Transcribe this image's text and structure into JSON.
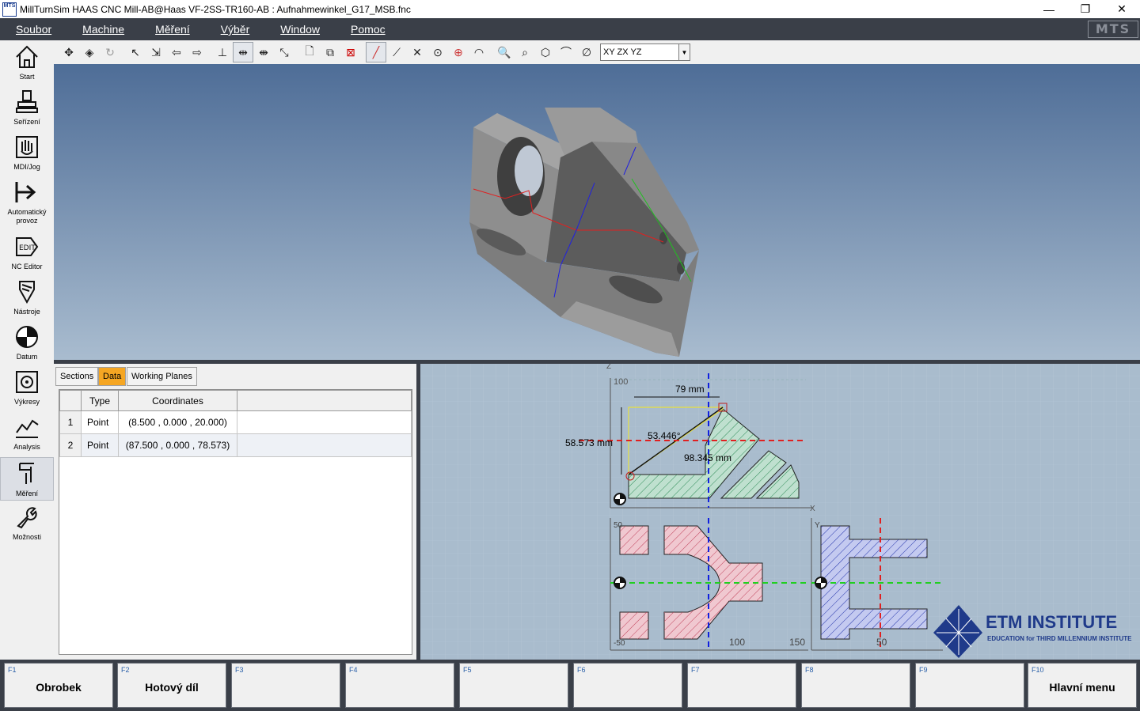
{
  "window": {
    "title": "MillTurnSim HAAS CNC Mill-AB@Haas VF-2SS-TR160-AB : Aufnahmewinkel_G17_MSB.fnc",
    "logo": "MTS",
    "minimize": "—",
    "restore": "❐",
    "close": "✕"
  },
  "menu": {
    "items": [
      "Soubor",
      "Machine",
      "Měření",
      "Výběr",
      "Window",
      "Pomoc"
    ],
    "logo": "MTS"
  },
  "sidebar": {
    "items": [
      {
        "label": "Start",
        "icon": "home-icon"
      },
      {
        "label": "Seřízení",
        "icon": "machine-setup-icon"
      },
      {
        "label": "MDI/Jog",
        "icon": "hand-jog-icon"
      },
      {
        "label": "Automatický provoz",
        "icon": "auto-run-icon"
      },
      {
        "label": "NC Editor",
        "icon": "edit-icon"
      },
      {
        "label": "Nástroje",
        "icon": "tool-icon"
      },
      {
        "label": "Datum",
        "icon": "datum-icon"
      },
      {
        "label": "Výkresy",
        "icon": "drawing-icon"
      },
      {
        "label": "Analysis",
        "icon": "analysis-icon"
      },
      {
        "label": "Měření",
        "icon": "measure-icon"
      },
      {
        "label": "Možnosti",
        "icon": "wrench-icon"
      }
    ]
  },
  "toolbar": {
    "plane_select": "XY ZX YZ"
  },
  "panel": {
    "tabs": [
      "Sections",
      "Data",
      "Working Planes"
    ],
    "active_tab": "Data",
    "columns": [
      "Type",
      "Coordinates"
    ],
    "rows": [
      {
        "n": "1",
        "type": "Point",
        "coords": "(8.500 , 0.000 , 20.000)"
      },
      {
        "n": "2",
        "type": "Point",
        "coords": "(87.500 , 0.000 , 78.573)"
      }
    ]
  },
  "drawing": {
    "dim_width": "79 mm",
    "dim_height": "58.573 mm",
    "dim_angle": "53.446°",
    "dim_diag": "98.345 mm",
    "z_label": "Z",
    "x_label": "X",
    "y_label": "Y",
    "t_100": "100",
    "t_50": "50",
    "t_150": "150",
    "t_m50": "-50",
    "t_50b": "50"
  },
  "brand": {
    "name": "ETM INSTITUTE",
    "tagline": "EDUCATION for THIRD MILLENNIUM INSTITUTE"
  },
  "fkeys": [
    {
      "key": "F1",
      "label": "Obrobek"
    },
    {
      "key": "F2",
      "label": "Hotový díl"
    },
    {
      "key": "F3",
      "label": ""
    },
    {
      "key": "F4",
      "label": ""
    },
    {
      "key": "F5",
      "label": ""
    },
    {
      "key": "F6",
      "label": ""
    },
    {
      "key": "F7",
      "label": ""
    },
    {
      "key": "F8",
      "label": ""
    },
    {
      "key": "F9",
      "label": ""
    },
    {
      "key": "F10",
      "label": "Hlavní menu"
    }
  ],
  "colors": {
    "accent_tab": "#f5a623",
    "dark_bar": "#3a3f48",
    "hatch_green": "#2e8b57",
    "hatch_red": "#c0405a",
    "hatch_blue": "#2233aa"
  }
}
